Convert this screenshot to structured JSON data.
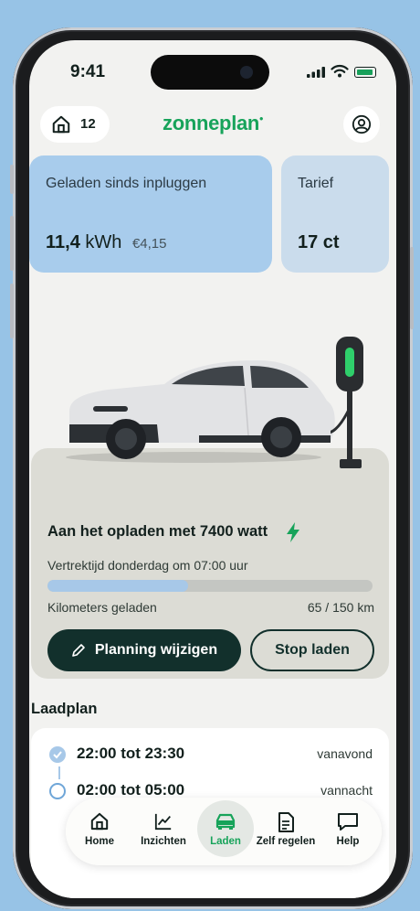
{
  "status_bar": {
    "time": "9:41"
  },
  "header": {
    "home_count": "12",
    "logo": "zonneplan",
    "logo_mark": "•"
  },
  "cards": {
    "charged": {
      "title": "Geladen sinds inpluggen",
      "value": "11,4",
      "unit": "kWh",
      "price": "€4,15"
    },
    "tariff": {
      "title": "Tarief",
      "value": "17 ct"
    }
  },
  "charging": {
    "heading": "Aan het opladen met 7400 watt",
    "departure": "Vertrektijd donderdag om 07:00 uur",
    "km_label": "Kilometers geladen",
    "km_value": "65 / 150 km",
    "progress_fraction": 0.433,
    "edit_button": "Planning wijzigen",
    "stop_button": "Stop laden"
  },
  "plan": {
    "title": "Laadplan",
    "slots": [
      {
        "time": "22:00 tot 23:30",
        "label": "vanavond",
        "state": "done"
      },
      {
        "time": "02:00 tot 05:00",
        "label": "vannacht",
        "state": "open"
      }
    ]
  },
  "nav": {
    "items": [
      {
        "label": "Home",
        "icon": "home-icon"
      },
      {
        "label": "Inzichten",
        "icon": "chart-icon"
      },
      {
        "label": "Laden",
        "icon": "car-icon",
        "active": true
      },
      {
        "label": "Zelf regelen",
        "icon": "document-icon"
      },
      {
        "label": "Help",
        "icon": "chat-icon"
      }
    ]
  },
  "colors": {
    "brand_green": "#17a35a",
    "dark_button": "#12302c",
    "card_blue": "#a8ccec",
    "card_light_blue": "#cadcec",
    "panel_bg": "#dcdcd5",
    "progress_fill": "#a7c8e8",
    "background_blue": "#97c3e6"
  }
}
